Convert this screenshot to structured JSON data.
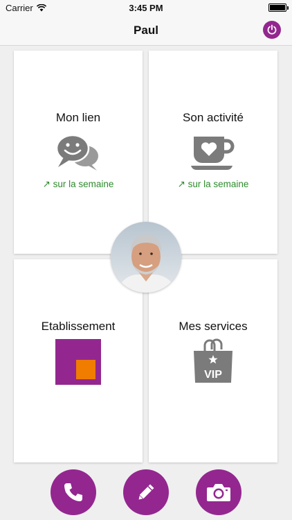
{
  "status": {
    "carrier": "Carrier",
    "time": "3:45 PM"
  },
  "header": {
    "title": "Paul"
  },
  "cards": [
    {
      "title": "Mon lien",
      "icon": "chat-smile-icon",
      "trend": "sur la semaine"
    },
    {
      "title": "Son activité",
      "icon": "coffee-cup-heart-icon",
      "trend": "sur la semaine"
    },
    {
      "title": "Etablissement",
      "icon": "establishment-logo-icon"
    },
    {
      "title": "Mes services",
      "icon": "vip-bag-icon",
      "icon_text": "VIP"
    }
  ],
  "trend_arrow": "↗",
  "actions": [
    {
      "icon": "phone-icon"
    },
    {
      "icon": "pencil-icon"
    },
    {
      "icon": "camera-icon"
    }
  ],
  "colors": {
    "accent": "#93278f",
    "trend": "#2e8b2e",
    "icon_gray": "#7b7b7b",
    "logo_orange": "#f07c00"
  }
}
